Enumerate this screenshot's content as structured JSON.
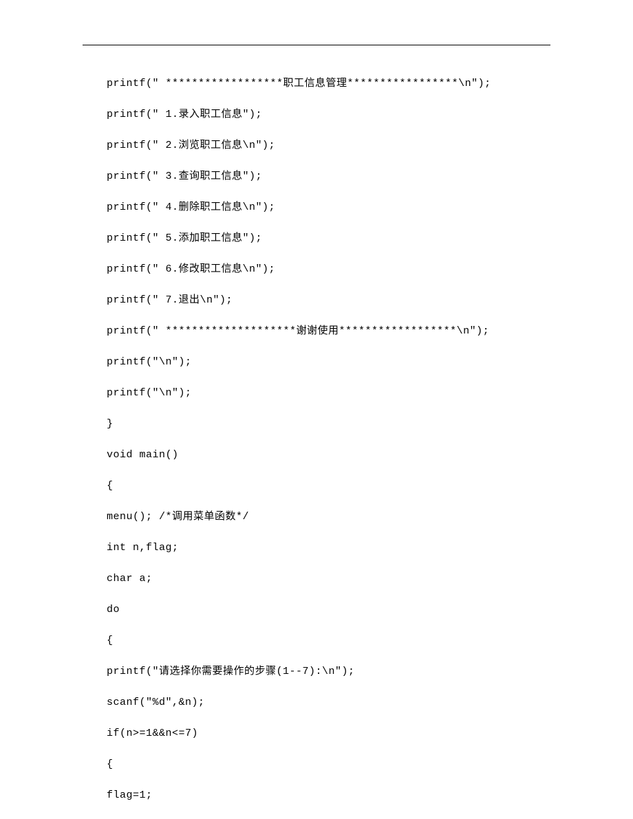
{
  "code": {
    "lines": [
      "printf(\" ******************职工信息管理*****************\\n\");",
      "printf(\" 1.录入职工信息\");",
      "printf(\" 2.浏览职工信息\\n\");",
      "printf(\" 3.查询职工信息\");",
      "printf(\" 4.删除职工信息\\n\");",
      "printf(\" 5.添加职工信息\");",
      "printf(\" 6.修改职工信息\\n\");",
      "printf(\" 7.退出\\n\");",
      "printf(\" ********************谢谢使用******************\\n\");",
      "printf(\"\\n\");",
      "printf(\"\\n\");",
      "}",
      "void main()",
      "{",
      "menu(); /*调用菜单函数*/",
      "int n,flag;",
      "char a;",
      "do",
      "{",
      "printf(\"请选择你需要操作的步骤(1--7):\\n\");",
      "scanf(\"%d\",&n);",
      "if(n>=1&&n<=7)",
      "{",
      "flag=1;"
    ]
  }
}
